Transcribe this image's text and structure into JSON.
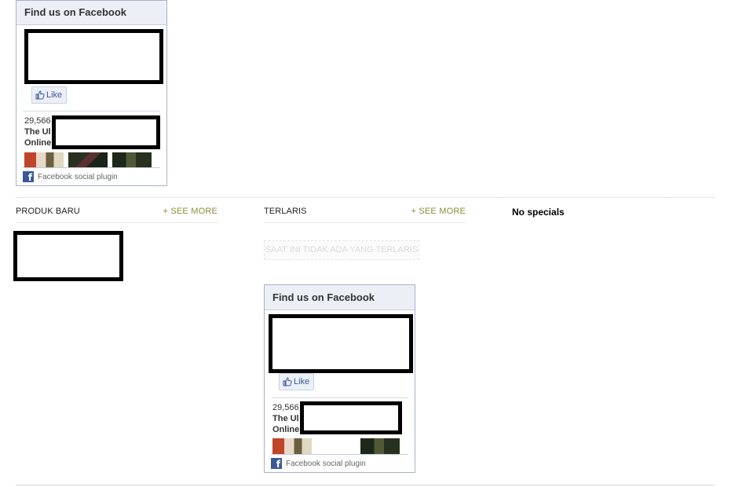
{
  "fb_widgets": [
    {
      "title": "Find us on Facebook",
      "like_label": "Like",
      "fan_count": "29,566",
      "page_name_part1": "The Ul",
      "page_name_part2": "Online",
      "footer_label": "Facebook social plugin"
    },
    {
      "title": "Find us on Facebook",
      "like_label": "Like",
      "fan_count": "29,566",
      "page_name_part1": "The Ul",
      "page_name_part2": "Online",
      "footer_label": "Facebook social plugin"
    }
  ],
  "sections": {
    "new_products": {
      "title": "PRODUK BARU",
      "see_more": "+ SEE MORE"
    },
    "best_sellers": {
      "title": "TERLARIS",
      "see_more": "+ SEE MORE",
      "empty_message": "SAAT INI TIDAK ADA YANG TERLARIS"
    },
    "specials": {
      "empty_message": "No specials"
    }
  },
  "colors": {
    "fb_blue": "#3b5998",
    "see_more": "#8e8c3a",
    "fb_header_bg": "#eceff5"
  }
}
